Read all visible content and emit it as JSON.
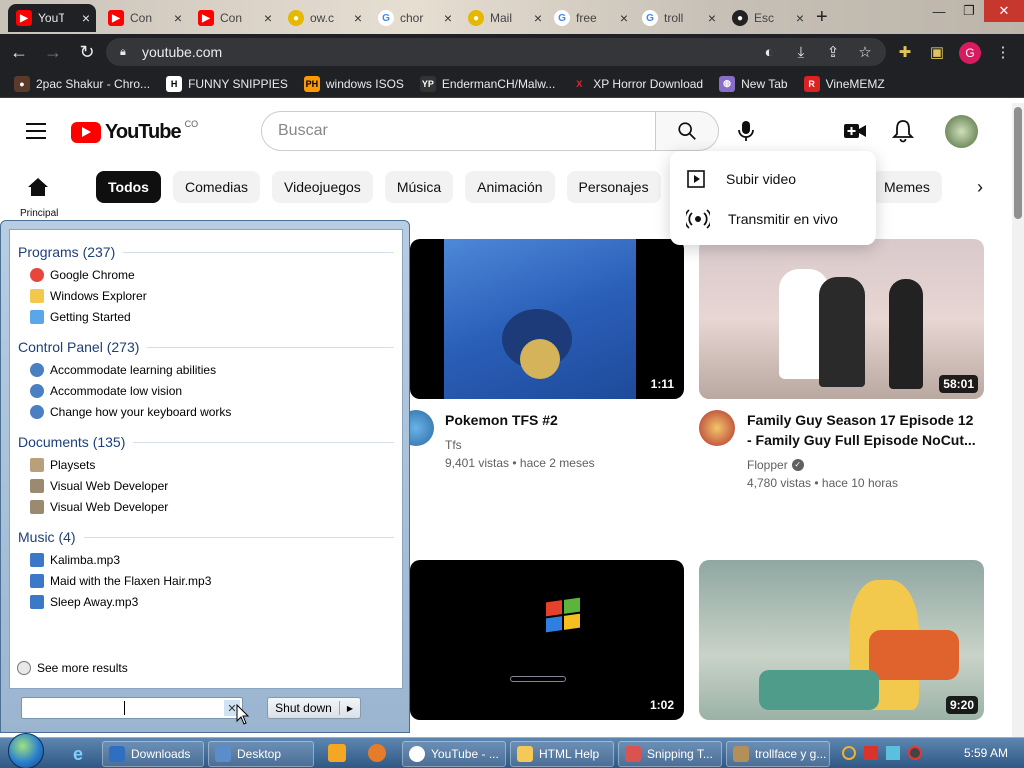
{
  "tabs": [
    {
      "title": "YouT",
      "icon": "youtube",
      "active": true
    },
    {
      "title": "Con",
      "icon": "youtube"
    },
    {
      "title": "Con",
      "icon": "youtube"
    },
    {
      "title": "ow.c",
      "icon": "other"
    },
    {
      "title": "chor",
      "icon": "google"
    },
    {
      "title": "Mail",
      "icon": "other"
    },
    {
      "title": "free",
      "icon": "google"
    },
    {
      "title": "troll",
      "icon": "google"
    },
    {
      "title": "Esc",
      "icon": "github"
    }
  ],
  "browser": {
    "url": "youtube.com",
    "profile_initial": "G"
  },
  "bookmarks": [
    {
      "label": "2pac Shakur - Chro...",
      "icon": "person-icon",
      "bg": "#5a3b2a",
      "fg": "#fff",
      "glyph": "●"
    },
    {
      "label": "FUNNY SNIPPIES",
      "icon": "h-icon",
      "bg": "#fff",
      "fg": "#000",
      "glyph": "H"
    },
    {
      "label": "windows ISOS",
      "icon": "ph-icon",
      "bg": "#ff9900",
      "fg": "#000",
      "glyph": "PH"
    },
    {
      "label": "EndermanCH/Malw...",
      "icon": "yp-icon",
      "bg": "#333",
      "fg": "#fff",
      "glyph": "YP"
    },
    {
      "label": "XP Horror Download",
      "icon": "x-icon",
      "bg": "#202124",
      "fg": "#e3262e",
      "glyph": "X"
    },
    {
      "label": "New Tab",
      "icon": "globe-icon",
      "bg": "#8a6cc9",
      "fg": "#fff",
      "glyph": "◍"
    },
    {
      "label": "VineMEMZ",
      "icon": "r-icon",
      "bg": "#d22",
      "fg": "#fff",
      "glyph": "R"
    }
  ],
  "youtube": {
    "logo_text": "YouTube",
    "region": "CO",
    "search_placeholder": "Buscar",
    "home_label": "Principal",
    "chips": [
      "Todos",
      "Comedias",
      "Videojuegos",
      "Música",
      "Animación",
      "Personajes"
    ],
    "chip_memes": "Memes",
    "create_menu": [
      "Subir video",
      "Transmitir en vivo"
    ],
    "videos": [
      {
        "title": "Pokemon TFS #2",
        "channel": "Tfs",
        "meta": "9,401 vistas • hace 2 meses",
        "duration": "1:11"
      },
      {
        "title_line1": "Family Guy Season 17 Episode 12",
        "title_line2": "- Family Guy Full Episode NoCut...",
        "channel": "Flopper",
        "meta": "4,780 vistas • hace 10 horas",
        "duration": "58:01"
      },
      {
        "duration": "1:02"
      },
      {
        "duration": "9:20"
      }
    ]
  },
  "startmenu": {
    "groups": [
      {
        "title": "Programs (237)",
        "items": [
          "Google Chrome",
          "Windows Explorer",
          "Getting Started"
        ]
      },
      {
        "title": "Control Panel (273)",
        "items": [
          "Accommodate learning abilities",
          "Accommodate low vision",
          "Change how your keyboard works"
        ]
      },
      {
        "title": "Documents (135)",
        "items": [
          "Playsets",
          "Visual Web Developer",
          "Visual Web Developer"
        ]
      },
      {
        "title": "Music (4)",
        "items": [
          "Kalimba.mp3",
          "Maid with the Flaxen Hair.mp3",
          "Sleep Away.mp3"
        ]
      }
    ],
    "see_more": "See more results",
    "shutdown": "Shut down"
  },
  "taskbar": {
    "items": [
      "Downloads",
      "Desktop",
      "YouTube - ...",
      "HTML Help",
      "Snipping T...",
      "trollface y g..."
    ],
    "clock": "5:59 AM"
  }
}
